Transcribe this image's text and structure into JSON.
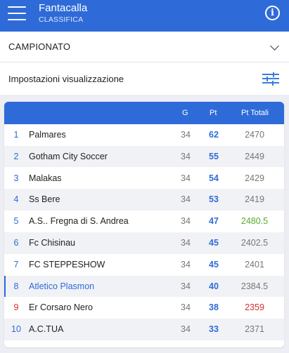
{
  "appbar": {
    "title": "Fantacalla",
    "subtitle": "CLASSIFICA",
    "info_glyph": "i"
  },
  "championship": {
    "label": "CAMPIONATO"
  },
  "display_settings": {
    "label": "Impostazioni visualizzazione"
  },
  "table": {
    "headers": {
      "g": "G",
      "pt": "Pt",
      "total": "Pt Totali"
    },
    "rows": [
      {
        "pos": "1",
        "team": "Palmares",
        "g": "34",
        "pt": "62",
        "total": "2470",
        "total_color": "#777777"
      },
      {
        "pos": "2",
        "team": "Gotham City Soccer",
        "g": "34",
        "pt": "55",
        "total": "2449",
        "total_color": "#777777"
      },
      {
        "pos": "3",
        "team": "Malakas",
        "g": "34",
        "pt": "54",
        "total": "2429",
        "total_color": "#777777"
      },
      {
        "pos": "4",
        "team": "Ss Bere",
        "g": "34",
        "pt": "53",
        "total": "2419",
        "total_color": "#777777"
      },
      {
        "pos": "5",
        "team": "A.S.. Fregna di S. Andrea",
        "g": "34",
        "pt": "47",
        "total": "2480.5",
        "total_color": "#5aa832"
      },
      {
        "pos": "6",
        "team": "Fc Chisinau",
        "g": "34",
        "pt": "45",
        "total": "2402.5",
        "total_color": "#777777"
      },
      {
        "pos": "7",
        "team": "FC STEPPESHOW",
        "g": "34",
        "pt": "45",
        "total": "2401",
        "total_color": "#777777"
      },
      {
        "pos": "8",
        "team": "Atletico Plasmon",
        "g": "34",
        "pt": "40",
        "total": "2384.5",
        "total_color": "#777777",
        "highlight": true
      },
      {
        "pos": "9",
        "team": "Er Corsaro Nero",
        "g": "34",
        "pt": "38",
        "total": "2359",
        "total_color": "#d32f2f",
        "pos_color": "#d32f2f"
      },
      {
        "pos": "10",
        "team": "A.C.TUA",
        "g": "34",
        "pt": "33",
        "total": "2371",
        "total_color": "#777777"
      }
    ]
  },
  "colors": {
    "primary": "#2f6bd8",
    "positive": "#5aa832",
    "negative": "#d32f2f"
  }
}
